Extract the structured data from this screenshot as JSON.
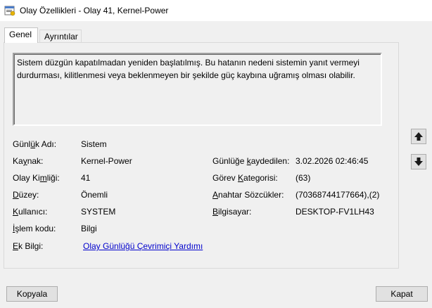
{
  "window": {
    "title": "Olay Özellikleri - Olay 41, Kernel-Power"
  },
  "tabs": [
    {
      "label": "Genel",
      "active": true
    },
    {
      "label": "Ayrıntılar",
      "active": false
    }
  ],
  "description": "Sistem düzgün kapatılmadan yeniden başlatılmış. Bu hatanın nedeni sistemin yanıt vermeyi durdurması, kilitlenmesi veya beklenmeyen bir şekilde güç kaybına uğramış olması olabilir.",
  "fields": {
    "log_name": {
      "value": "Sistem"
    },
    "source": {
      "value": "Kernel-Power"
    },
    "event_id": {
      "value": "41"
    },
    "level": {
      "value": "Önemli"
    },
    "user": {
      "value": "SYSTEM"
    },
    "opcode": {
      "value": "Bilgi"
    },
    "more_info": {
      "value": "Olay Günlüğü Çevrimiçi Yardımı"
    },
    "logged": {
      "value": "3.02.2026 02:46:45"
    },
    "task_category": {
      "value": "(63)"
    },
    "keywords": {
      "value": "(70368744177664),(2)"
    },
    "computer": {
      "value": "DESKTOP-FV1LH43"
    }
  },
  "buttons": {
    "copy": "Kopyala",
    "close": "Kapat"
  }
}
